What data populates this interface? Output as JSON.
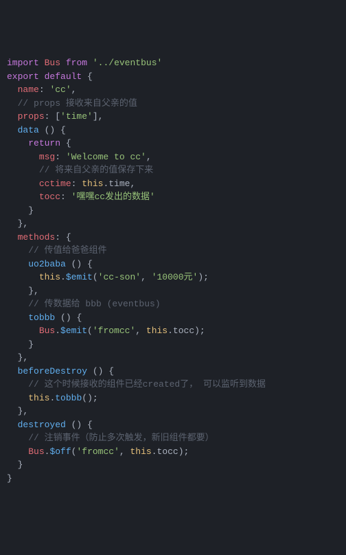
{
  "lines": [
    {
      "segments": [
        {
          "t": "import",
          "c": "kw"
        },
        {
          "t": " ",
          "c": "pn"
        },
        {
          "t": "Bus",
          "c": "var"
        },
        {
          "t": " ",
          "c": "pn"
        },
        {
          "t": "from",
          "c": "kw"
        },
        {
          "t": " ",
          "c": "pn"
        },
        {
          "t": "'../eventbus'",
          "c": "str"
        }
      ]
    },
    {
      "segments": [
        {
          "t": "export",
          "c": "kw"
        },
        {
          "t": " ",
          "c": "pn"
        },
        {
          "t": "default",
          "c": "df"
        },
        {
          "t": " {",
          "c": "pn"
        }
      ]
    },
    {
      "segments": [
        {
          "t": "  ",
          "c": "pn"
        },
        {
          "t": "name",
          "c": "prop"
        },
        {
          "t": ": ",
          "c": "pn"
        },
        {
          "t": "'cc'",
          "c": "str"
        },
        {
          "t": ",",
          "c": "pn"
        }
      ]
    },
    {
      "segments": [
        {
          "t": "  ",
          "c": "pn"
        },
        {
          "t": "// props 接收来自父亲的值",
          "c": "cm"
        }
      ]
    },
    {
      "segments": [
        {
          "t": "  ",
          "c": "pn"
        },
        {
          "t": "props",
          "c": "prop"
        },
        {
          "t": ": [",
          "c": "pn"
        },
        {
          "t": "'time'",
          "c": "str"
        },
        {
          "t": "],",
          "c": "pn"
        }
      ]
    },
    {
      "segments": [
        {
          "t": "  ",
          "c": "pn"
        },
        {
          "t": "data",
          "c": "fn"
        },
        {
          "t": " () {",
          "c": "pn"
        }
      ]
    },
    {
      "segments": [
        {
          "t": "    ",
          "c": "pn"
        },
        {
          "t": "return",
          "c": "kw"
        },
        {
          "t": " {",
          "c": "pn"
        }
      ]
    },
    {
      "segments": [
        {
          "t": "      ",
          "c": "pn"
        },
        {
          "t": "msg",
          "c": "prop"
        },
        {
          "t": ": ",
          "c": "pn"
        },
        {
          "t": "'Welcome to cc'",
          "c": "str"
        },
        {
          "t": ",",
          "c": "pn"
        }
      ]
    },
    {
      "segments": [
        {
          "t": "      ",
          "c": "pn"
        },
        {
          "t": "// 将来自父亲的值保存下来",
          "c": "cm"
        }
      ]
    },
    {
      "segments": [
        {
          "t": "      ",
          "c": "pn"
        },
        {
          "t": "cctime",
          "c": "prop"
        },
        {
          "t": ": ",
          "c": "pn"
        },
        {
          "t": "this",
          "c": "th"
        },
        {
          "t": ".time,",
          "c": "pn"
        }
      ]
    },
    {
      "segments": [
        {
          "t": "      ",
          "c": "pn"
        },
        {
          "t": "tocc",
          "c": "prop"
        },
        {
          "t": ": ",
          "c": "pn"
        },
        {
          "t": "'嘿嘿cc发出的数据'",
          "c": "str"
        }
      ]
    },
    {
      "segments": [
        {
          "t": "    }",
          "c": "pn"
        }
      ]
    },
    {
      "segments": [
        {
          "t": "  },",
          "c": "pn"
        }
      ]
    },
    {
      "segments": [
        {
          "t": "  ",
          "c": "pn"
        },
        {
          "t": "methods",
          "c": "prop"
        },
        {
          "t": ": {",
          "c": "pn"
        }
      ]
    },
    {
      "segments": [
        {
          "t": "    ",
          "c": "pn"
        },
        {
          "t": "// 传值给爸爸组件",
          "c": "cm"
        }
      ]
    },
    {
      "segments": [
        {
          "t": "    ",
          "c": "pn"
        },
        {
          "t": "uo2baba",
          "c": "fn"
        },
        {
          "t": " () {",
          "c": "pn"
        }
      ]
    },
    {
      "segments": [
        {
          "t": "      ",
          "c": "pn"
        },
        {
          "t": "this",
          "c": "th"
        },
        {
          "t": ".",
          "c": "pn"
        },
        {
          "t": "$emit",
          "c": "fn"
        },
        {
          "t": "(",
          "c": "pn"
        },
        {
          "t": "'cc-son'",
          "c": "str"
        },
        {
          "t": ", ",
          "c": "pn"
        },
        {
          "t": "'10000元'",
          "c": "str"
        },
        {
          "t": ");",
          "c": "pn"
        }
      ]
    },
    {
      "segments": [
        {
          "t": "    },",
          "c": "pn"
        }
      ]
    },
    {
      "segments": [
        {
          "t": "    ",
          "c": "pn"
        },
        {
          "t": "// 传数据给 bbb (eventbus)",
          "c": "cm"
        }
      ]
    },
    {
      "segments": [
        {
          "t": "    ",
          "c": "pn"
        },
        {
          "t": "tobbb",
          "c": "fn"
        },
        {
          "t": " () {",
          "c": "pn"
        }
      ]
    },
    {
      "segments": [
        {
          "t": "      ",
          "c": "pn"
        },
        {
          "t": "Bus",
          "c": "var"
        },
        {
          "t": ".",
          "c": "pn"
        },
        {
          "t": "$emit",
          "c": "fn"
        },
        {
          "t": "(",
          "c": "pn"
        },
        {
          "t": "'fromcc'",
          "c": "str"
        },
        {
          "t": ", ",
          "c": "pn"
        },
        {
          "t": "this",
          "c": "th"
        },
        {
          "t": ".tocc);",
          "c": "pn"
        }
      ]
    },
    {
      "segments": [
        {
          "t": "    }",
          "c": "pn"
        }
      ]
    },
    {
      "segments": [
        {
          "t": "  },",
          "c": "pn"
        }
      ]
    },
    {
      "segments": [
        {
          "t": "  ",
          "c": "pn"
        },
        {
          "t": "beforeDestroy",
          "c": "fn"
        },
        {
          "t": " () {",
          "c": "pn"
        }
      ]
    },
    {
      "segments": [
        {
          "t": "    ",
          "c": "pn"
        },
        {
          "t": "// 这个时候接收的组件已经created了， 可以监听到数据",
          "c": "cm"
        }
      ]
    },
    {
      "segments": [
        {
          "t": "    ",
          "c": "pn"
        },
        {
          "t": "this",
          "c": "th"
        },
        {
          "t": ".",
          "c": "pn"
        },
        {
          "t": "tobbb",
          "c": "fn"
        },
        {
          "t": "();",
          "c": "pn"
        }
      ]
    },
    {
      "segments": [
        {
          "t": "",
          "c": "pn"
        }
      ]
    },
    {
      "segments": [
        {
          "t": "  },",
          "c": "pn"
        }
      ]
    },
    {
      "segments": [
        {
          "t": "  ",
          "c": "pn"
        },
        {
          "t": "destroyed",
          "c": "fn"
        },
        {
          "t": " () {",
          "c": "pn"
        }
      ]
    },
    {
      "segments": [
        {
          "t": "    ",
          "c": "pn"
        },
        {
          "t": "// 注销事件（防止多次触发，新旧组件都要）",
          "c": "cm"
        }
      ]
    },
    {
      "segments": [
        {
          "t": "    ",
          "c": "pn"
        },
        {
          "t": "Bus",
          "c": "var"
        },
        {
          "t": ".",
          "c": "pn"
        },
        {
          "t": "$off",
          "c": "fn"
        },
        {
          "t": "(",
          "c": "pn"
        },
        {
          "t": "'fromcc'",
          "c": "str"
        },
        {
          "t": ", ",
          "c": "pn"
        },
        {
          "t": "this",
          "c": "th"
        },
        {
          "t": ".tocc);",
          "c": "pn"
        }
      ]
    },
    {
      "segments": [
        {
          "t": "  }",
          "c": "pn"
        }
      ]
    },
    {
      "segments": [
        {
          "t": "}",
          "c": "pn"
        }
      ]
    }
  ]
}
